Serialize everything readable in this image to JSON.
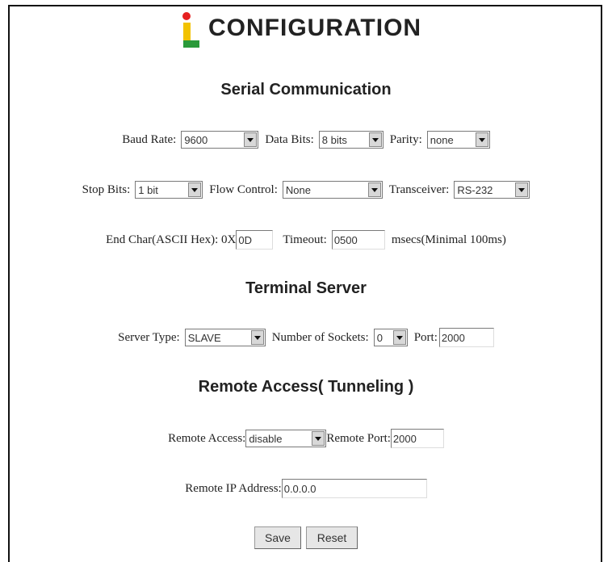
{
  "header": {
    "title": "CONFIGURATION",
    "logo_colors": [
      "#e62020",
      "#f2c200",
      "#2a9a3a"
    ]
  },
  "serial": {
    "heading": "Serial Communication",
    "baud_rate_label": "Baud Rate:",
    "baud_rate_value": "9600",
    "data_bits_label": "Data Bits:",
    "data_bits_value": "8 bits",
    "parity_label": "Parity:",
    "parity_value": "none",
    "stop_bits_label": "Stop Bits:",
    "stop_bits_value": "1 bit",
    "flow_control_label": "Flow Control:",
    "flow_control_value": "None",
    "transceiver_label": "Transceiver:",
    "transceiver_value": "RS-232",
    "end_char_label": "End Char(ASCII Hex): 0X",
    "end_char_value": "0D",
    "timeout_label": "Timeout:",
    "timeout_value": "0500",
    "timeout_unit": "msecs(Minimal 100ms)"
  },
  "terminal": {
    "heading": "Terminal Server",
    "server_type_label": "Server Type:",
    "server_type_value": "SLAVE",
    "sockets_label": "Number of Sockets:",
    "sockets_value": "0",
    "port_label": "Port:",
    "port_value": "2000"
  },
  "remote": {
    "heading": "Remote Access( Tunneling )",
    "access_label": "Remote Access:",
    "access_value": "disable",
    "remote_port_label": "Remote Port:",
    "remote_port_value": "2000",
    "ip_label": "Remote IP Address:",
    "ip_value": "0.0.0.0"
  },
  "buttons": {
    "save": "Save",
    "reset": "Reset"
  }
}
